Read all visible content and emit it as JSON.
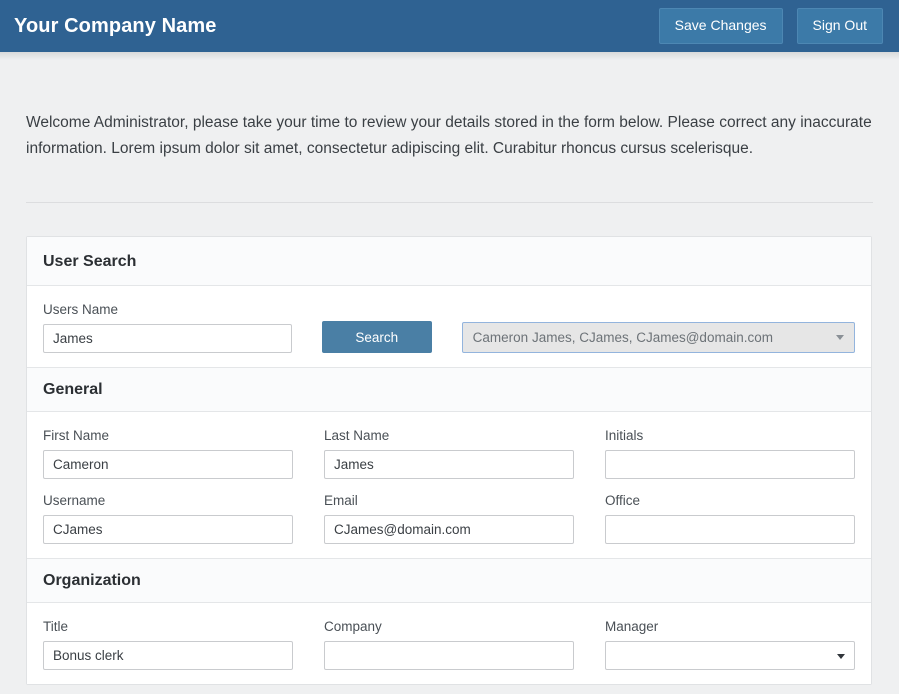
{
  "header": {
    "brand": "Your Company Name",
    "save_label": "Save Changes",
    "signout_label": "Sign Out",
    "bar_color": "#2f6292",
    "button_color": "#3c7aa8"
  },
  "intro": {
    "text": "Welcome Administrator, please take your time to review your details stored in the form below. Please correct any inaccurate information. Lorem ipsum dolor sit amet, consectetur adipiscing elit. Curabitur rhoncus cursus scelerisque."
  },
  "panel": {
    "title": "User Search",
    "search": {
      "label": "Users Name",
      "value": "James",
      "placeholder": "",
      "button_label": "Search",
      "button_color": "#4a7fa5",
      "result": {
        "selected": "Cameron James, CJames, CJames@domain.com",
        "caret_icon": "chevron-down-icon"
      }
    },
    "sections": [
      {
        "title": "General",
        "rows": [
          [
            {
              "label": "First Name",
              "value": "Cameron",
              "type": "text"
            },
            {
              "label": "Last Name",
              "value": "James",
              "type": "text"
            },
            {
              "label": "Initials",
              "value": "",
              "type": "text"
            }
          ],
          [
            {
              "label": "Username",
              "value": "CJames",
              "type": "text"
            },
            {
              "label": "Email",
              "value": "CJames@domain.com",
              "type": "text"
            },
            {
              "label": "Office",
              "value": "",
              "type": "text"
            }
          ]
        ]
      },
      {
        "title": "Organization",
        "rows": [
          [
            {
              "label": "Title",
              "value": "Bonus clerk",
              "type": "text"
            },
            {
              "label": "Company",
              "value": "",
              "type": "text"
            },
            {
              "label": "Manager",
              "value": "",
              "type": "select"
            }
          ]
        ]
      }
    ]
  }
}
